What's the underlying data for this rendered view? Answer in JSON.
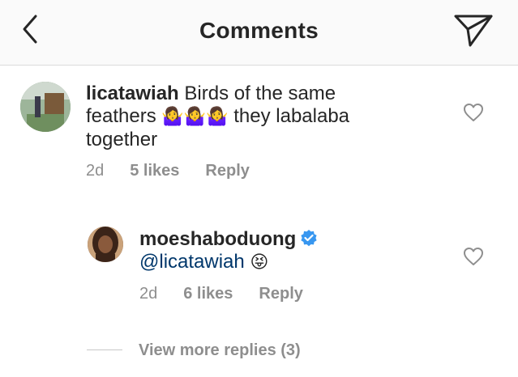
{
  "header": {
    "title": "Comments",
    "back_icon": "chevron-left-icon",
    "send_icon": "paper-plane-icon"
  },
  "comments": [
    {
      "username": "licatawiah",
      "text": "Birds of the same feathers",
      "emojis": "🤷‍♀️🤷‍♀️🤷‍♀️",
      "text_after": "they labalaba together",
      "time": "2d",
      "likes": "5 likes",
      "reply": "Reply"
    },
    {
      "username": "moeshaboduong",
      "verified": true,
      "mention": "@licatawiah",
      "emoji": "😝",
      "time": "2d",
      "likes": "6 likes",
      "reply": "Reply"
    }
  ],
  "view_more_replies": "View more replies (3)",
  "colors": {
    "header_bg": "#fafafa",
    "text": "#262626",
    "meta": "#8e8e8e",
    "mention": "#00376b",
    "verified": "#3897f0"
  }
}
